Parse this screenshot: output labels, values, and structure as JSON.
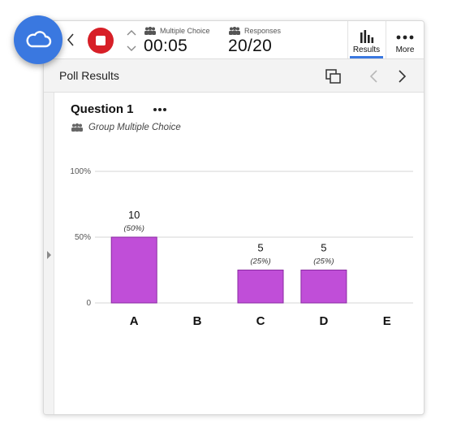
{
  "toolbar": {
    "type_label": "Multiple Choice",
    "timer": "00:05",
    "responses_label": "Responses",
    "responses_value": "20/20",
    "results_label": "Results",
    "more_label": "More"
  },
  "subbar": {
    "title": "Poll Results"
  },
  "question": {
    "title": "Question 1",
    "subtitle": "Group Multiple Choice"
  },
  "colors": {
    "bar": "#c04ed8",
    "bar_border": "#8a2aa2",
    "accent": "#3a78e0",
    "stop": "#d71f27"
  },
  "chart_data": {
    "type": "bar",
    "categories": [
      "A",
      "B",
      "C",
      "D",
      "E"
    ],
    "values": [
      10,
      0,
      5,
      5,
      0
    ],
    "percent_labels": [
      "(50%)",
      "",
      "(25%)",
      "(25%)",
      ""
    ],
    "count_labels": [
      "10",
      "",
      "5",
      "5",
      ""
    ],
    "yticks": [
      "100%",
      "50%",
      "0"
    ],
    "ylim": [
      0,
      100
    ],
    "title": "",
    "xlabel": "",
    "ylabel": ""
  }
}
